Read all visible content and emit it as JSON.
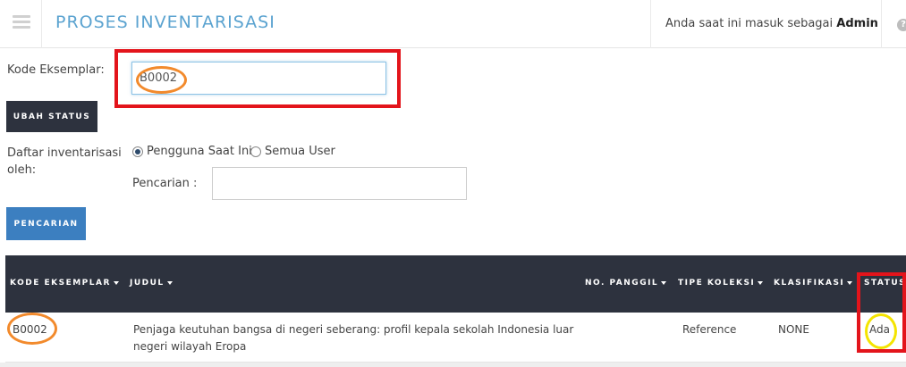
{
  "header": {
    "title": "PROSES INVENTARISASI",
    "user_prefix": "Anda saat ini masuk sebagai",
    "user_name": "Admin",
    "help_glyph": "?"
  },
  "form": {
    "kode_label": "Kode Eksemplar:",
    "kode_value": "B0002",
    "ubah_status_label": "UBAH STATUS",
    "daftar_label_line1": "Daftar inventarisasi",
    "daftar_label_line2": "oleh:",
    "radio_current": "Pengguna Saat Ini",
    "radio_all": "Semua User",
    "radio_selected": "Pengguna Saat Ini",
    "pencarian_label": "Pencarian :",
    "pencarian_value": "",
    "pencarian_button": "PENCARIAN"
  },
  "table": {
    "columns": [
      "KODE EKSEMPLAR",
      "JUDUL",
      "NO. PANGGIL",
      "TIPE KOLEKSI",
      "KLASIFIKASI",
      "STATUS"
    ],
    "rows": [
      {
        "kode": "B0002",
        "judul_line1": "Penjaga keutuhan bangsa di negeri seberang: profil kepala sekolah Indonesia luar",
        "judul_line2": "negeri wilayah Eropa",
        "no_panggil": "",
        "tipe_koleksi": "Reference",
        "klasifikasi": "NONE",
        "status": "Ada"
      }
    ]
  },
  "colors": {
    "title_blue": "#5ba3d0",
    "dark_button": "#2d323e",
    "blue_button": "#3c7fc0",
    "annotation_red": "#e3141b",
    "annotation_orange": "#f28a2c",
    "annotation_yellow": "#f4e400"
  },
  "icons": {
    "menu": "hamburger-icon",
    "help": "help-icon",
    "sort": "caret-down-icon"
  }
}
